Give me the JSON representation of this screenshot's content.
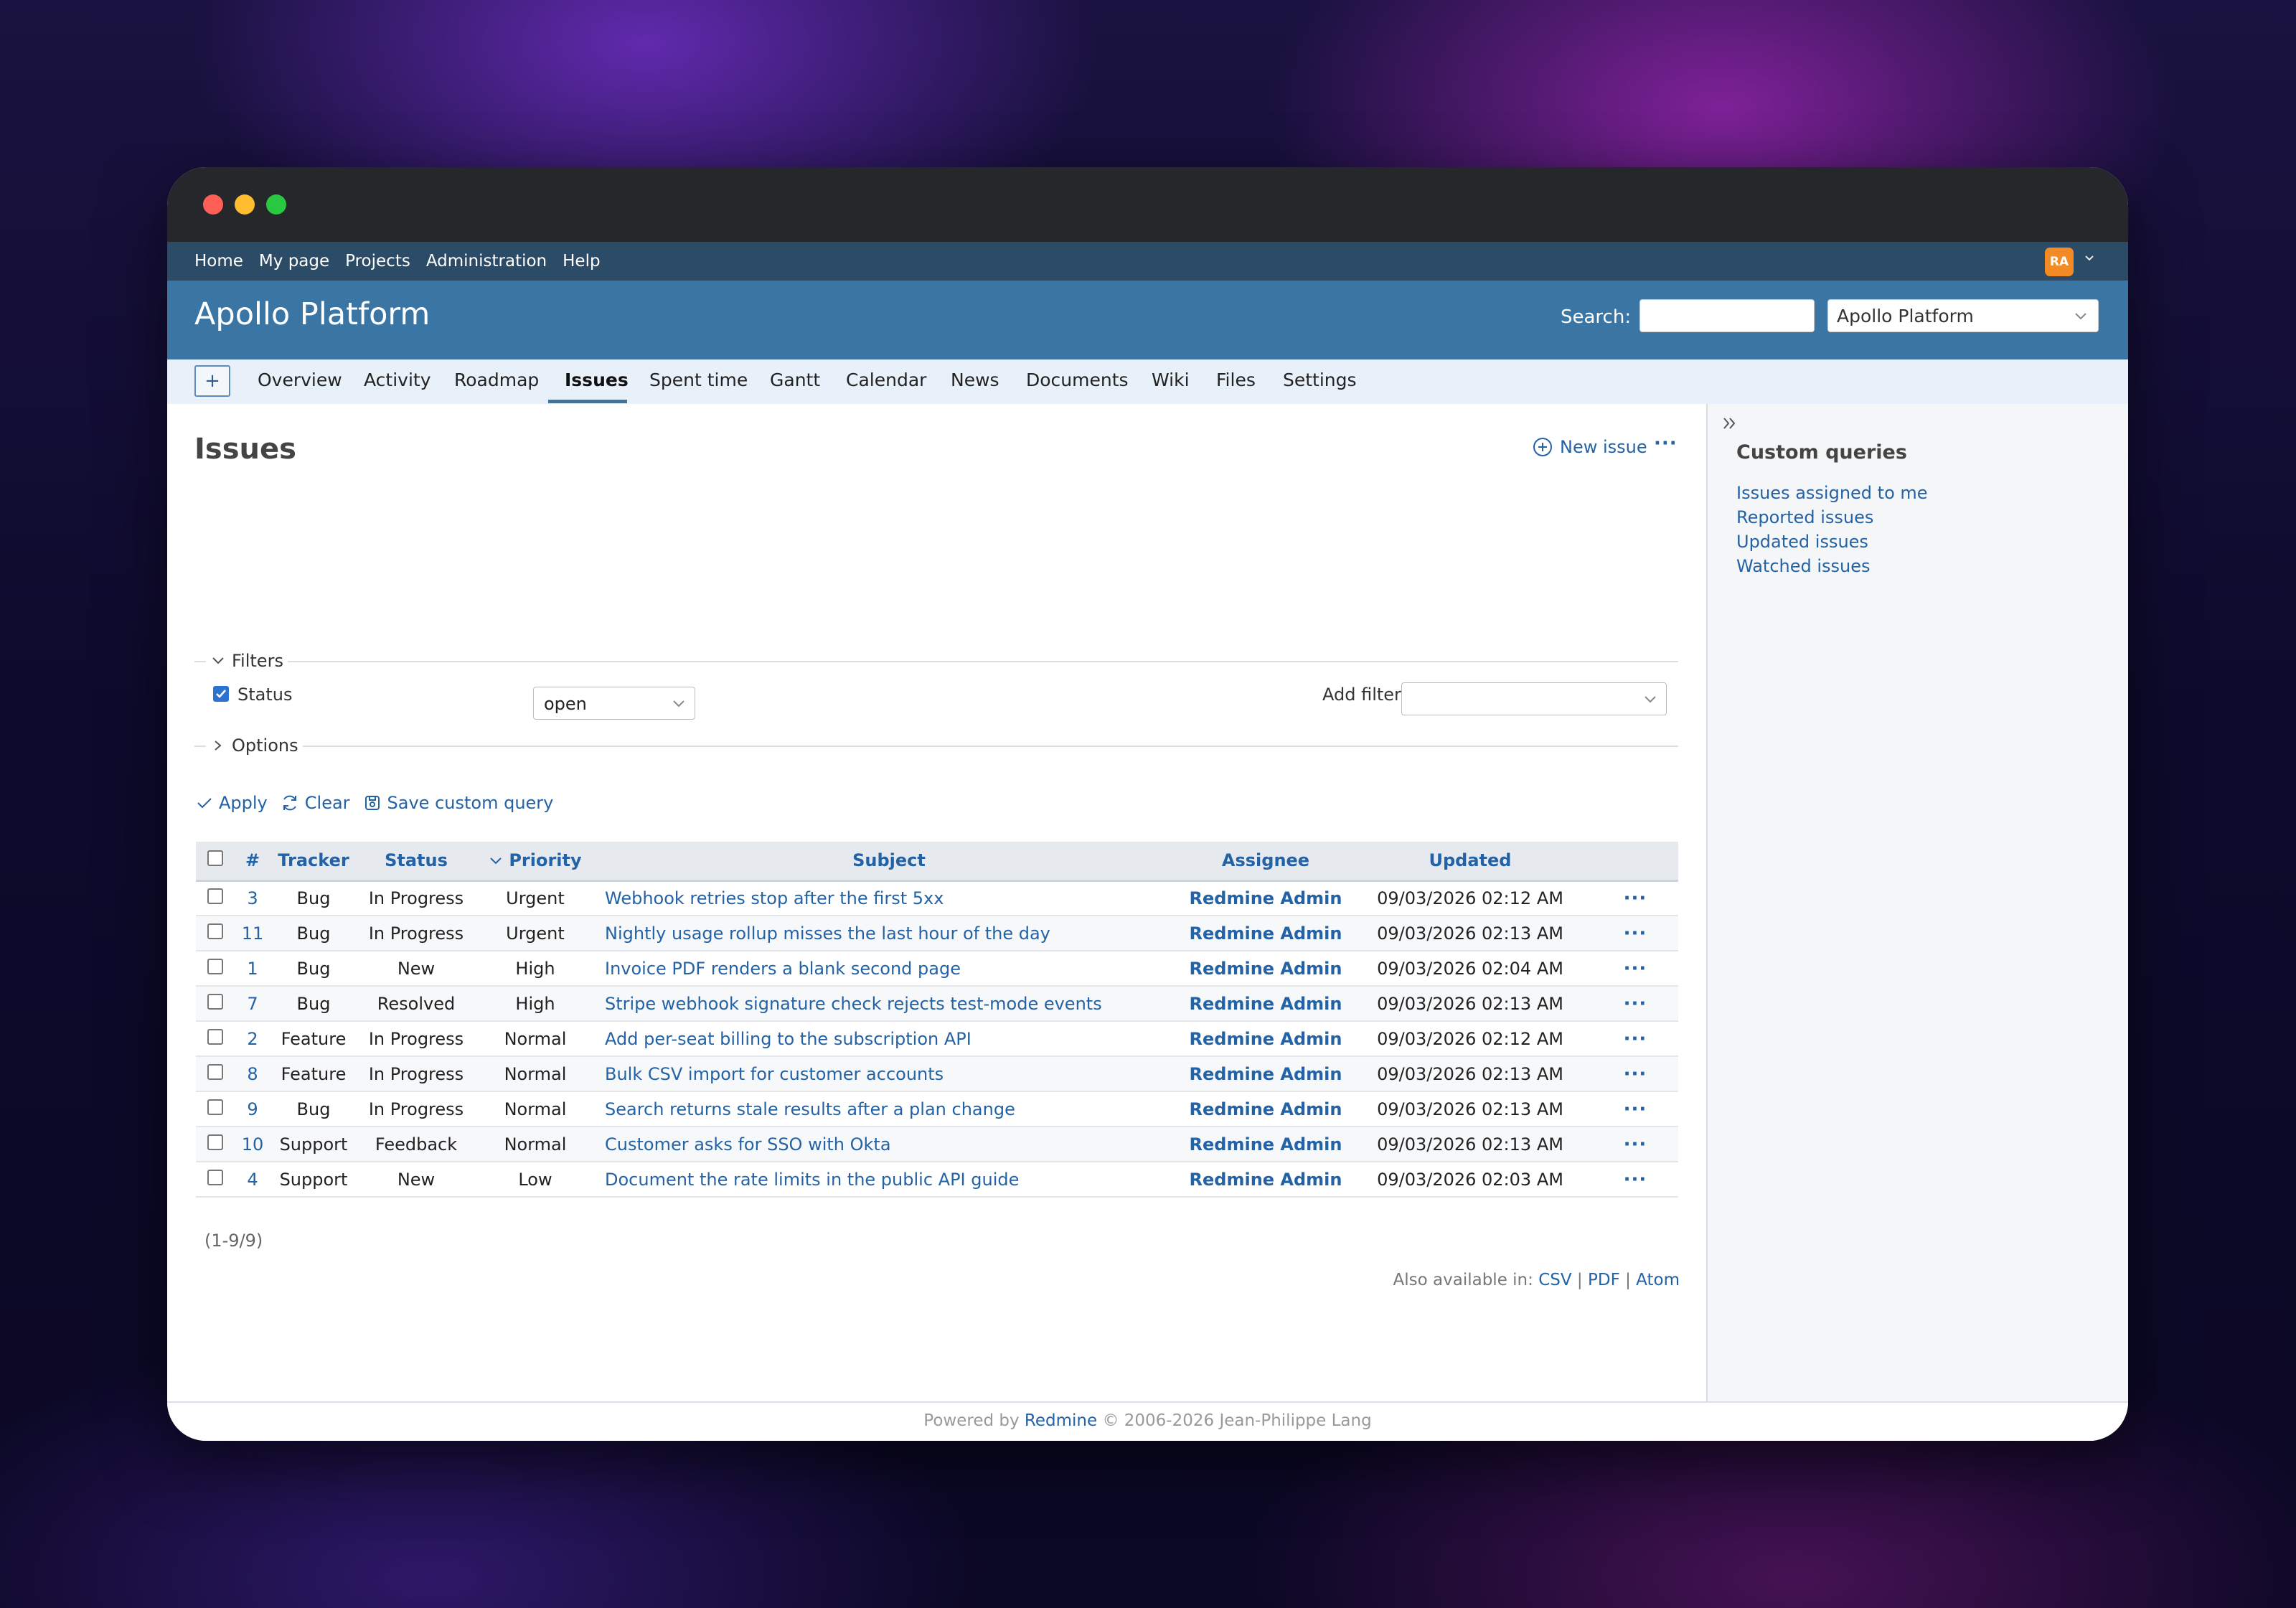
{
  "top_menu": {
    "items": [
      "Home",
      "My page",
      "Projects",
      "Administration",
      "Help"
    ],
    "avatar_initials": "RA"
  },
  "header": {
    "project_title": "Apollo Platform",
    "search_label": "Search:",
    "search_value": "",
    "project_select_value": "Apollo Platform"
  },
  "tabs": {
    "new_label": "+",
    "items": [
      "Overview",
      "Activity",
      "Roadmap",
      "Issues",
      "Spent time",
      "Gantt",
      "Calendar",
      "News",
      "Documents",
      "Wiki",
      "Files",
      "Settings"
    ],
    "active": "Issues"
  },
  "page": {
    "title": "Issues",
    "new_issue_label": "New issue",
    "more_label": "···"
  },
  "filters": {
    "legend": "Filters",
    "status_label": "Status",
    "status_checked": true,
    "status_operator": "open",
    "add_filter_label": "Add filter",
    "add_filter_value": "",
    "options_legend": "Options"
  },
  "actions": {
    "apply": "Apply",
    "clear": "Clear",
    "save": "Save custom query"
  },
  "table": {
    "columns": [
      "#",
      "Tracker",
      "Status",
      "Priority",
      "Subject",
      "Assignee",
      "Updated"
    ],
    "sorted_column": "Priority",
    "rows": [
      {
        "id": "3",
        "tracker": "Bug",
        "status": "In Progress",
        "priority": "Urgent",
        "subject": "Webhook retries stop after the first 5xx",
        "assignee": "Redmine Admin",
        "updated": "09/03/2026 02:12 AM"
      },
      {
        "id": "11",
        "tracker": "Bug",
        "status": "In Progress",
        "priority": "Urgent",
        "subject": "Nightly usage rollup misses the last hour of the day",
        "assignee": "Redmine Admin",
        "updated": "09/03/2026 02:13 AM"
      },
      {
        "id": "1",
        "tracker": "Bug",
        "status": "New",
        "priority": "High",
        "subject": "Invoice PDF renders a blank second page",
        "assignee": "Redmine Admin",
        "updated": "09/03/2026 02:04 AM"
      },
      {
        "id": "7",
        "tracker": "Bug",
        "status": "Resolved",
        "priority": "High",
        "subject": "Stripe webhook signature check rejects test-mode events",
        "assignee": "Redmine Admin",
        "updated": "09/03/2026 02:13 AM"
      },
      {
        "id": "2",
        "tracker": "Feature",
        "status": "In Progress",
        "priority": "Normal",
        "subject": "Add per-seat billing to the subscription API",
        "assignee": "Redmine Admin",
        "updated": "09/03/2026 02:12 AM"
      },
      {
        "id": "8",
        "tracker": "Feature",
        "status": "In Progress",
        "priority": "Normal",
        "subject": "Bulk CSV import for customer accounts",
        "assignee": "Redmine Admin",
        "updated": "09/03/2026 02:13 AM"
      },
      {
        "id": "9",
        "tracker": "Bug",
        "status": "In Progress",
        "priority": "Normal",
        "subject": "Search returns stale results after a plan change",
        "assignee": "Redmine Admin",
        "updated": "09/03/2026 02:13 AM"
      },
      {
        "id": "10",
        "tracker": "Support",
        "status": "Feedback",
        "priority": "Normal",
        "subject": "Customer asks for SSO with Okta",
        "assignee": "Redmine Admin",
        "updated": "09/03/2026 02:13 AM"
      },
      {
        "id": "4",
        "tracker": "Support",
        "status": "New",
        "priority": "Low",
        "subject": "Document the rate limits in the public API guide",
        "assignee": "Redmine Admin",
        "updated": "09/03/2026 02:03 AM"
      }
    ],
    "row_more_label": "···",
    "count_label": "(1-9/9)"
  },
  "other_formats": {
    "label": "Also available in:",
    "formats": [
      "CSV",
      "PDF",
      "Atom"
    ],
    "separator": "|"
  },
  "sidebar": {
    "heading": "Custom queries",
    "links": [
      "Issues assigned to me",
      "Reported issues",
      "Updated issues",
      "Watched issues"
    ]
  },
  "footer": {
    "prefix": "Powered by",
    "link": "Redmine",
    "suffix": "© 2006-2026 Jean-Philippe Lang"
  },
  "colors": {
    "header_bg": "#3b75a4",
    "top_menu_bg": "#2c4b67",
    "link": "#2462a6",
    "tabs_bg": "#e8f0f9",
    "avatar_bg": "#f28b25"
  }
}
